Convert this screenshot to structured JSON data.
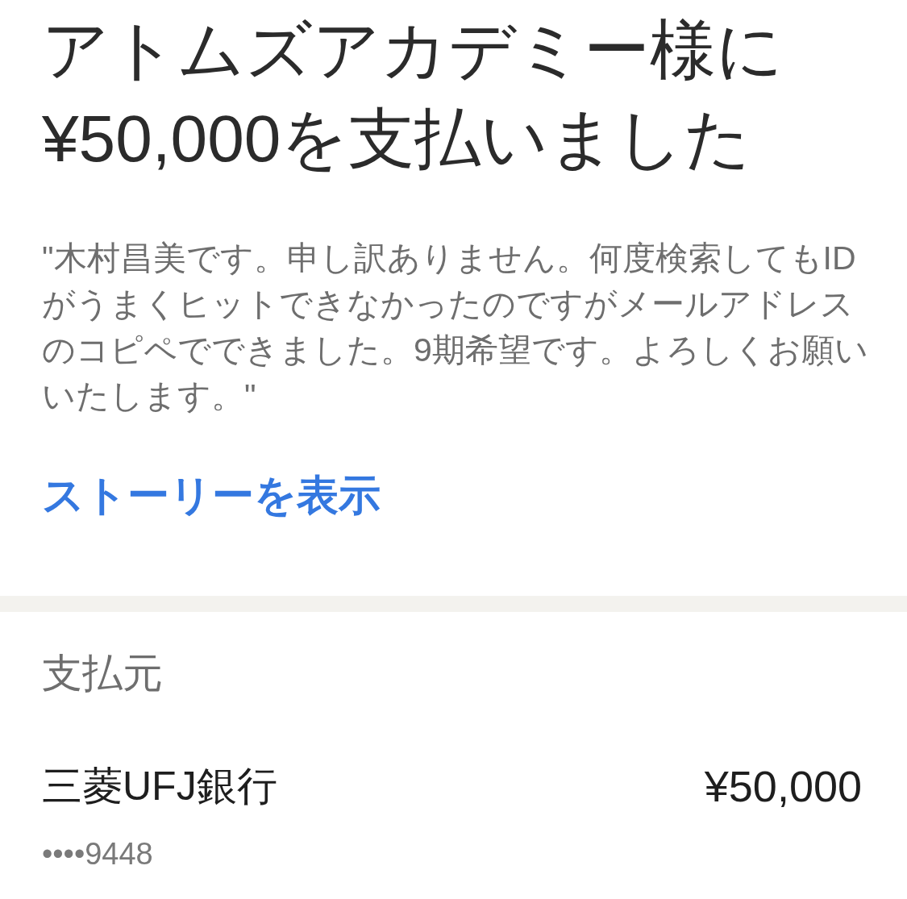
{
  "header": {
    "title": "アトムズアカデミー様に¥50,000を支払いました"
  },
  "message": "\"木村昌美です。申し訳ありません。何度検索してもIDがうまくヒットできなかったのですがメールアドレスのコピペでできました。9期希望です。よろしくお願いいたします。\"",
  "story_link": "ストーリーを表示",
  "payment_source": {
    "label": "支払元",
    "account_name": "三菱UFJ銀行",
    "amount": "¥50,000",
    "account_number": "••••9448"
  }
}
